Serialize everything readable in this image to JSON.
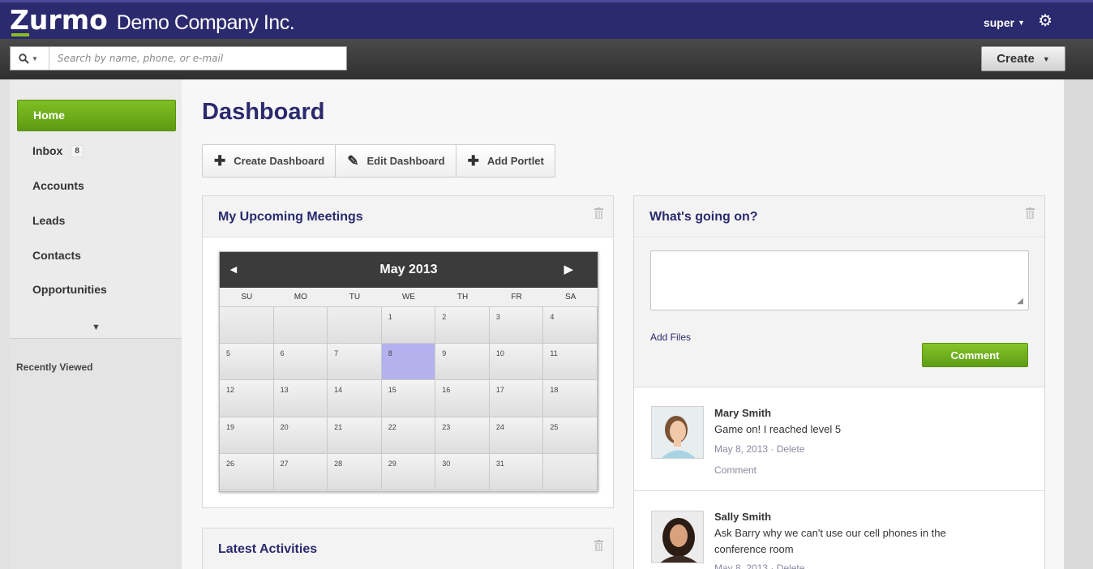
{
  "header": {
    "logo_text": "Zurmo",
    "company_name": "Demo Company Inc.",
    "user_name": "super",
    "gear_icon": "gear-icon",
    "brand_color": "#2b2a6e",
    "accent_color": "#6aaa1a"
  },
  "toolbar": {
    "search_placeholder": "Search by name, phone, or e-mail",
    "create_label": "Create"
  },
  "sidebar": {
    "items": [
      {
        "label": "Home",
        "active": true
      },
      {
        "label": "Inbox",
        "badge": "8"
      },
      {
        "label": "Accounts"
      },
      {
        "label": "Leads"
      },
      {
        "label": "Contacts"
      },
      {
        "label": "Opportunities"
      }
    ],
    "recent_label": "Recently Viewed"
  },
  "main": {
    "title": "Dashboard",
    "actions": [
      {
        "label": "Create Dashboard",
        "icon": "plus-icon"
      },
      {
        "label": "Edit Dashboard",
        "icon": "pencil-icon"
      },
      {
        "label": "Add Portlet",
        "icon": "plus-icon"
      }
    ]
  },
  "meetings": {
    "title": "My Upcoming Meetings",
    "calendar": {
      "month": "May 2013",
      "dows": [
        "SU",
        "MO",
        "TU",
        "WE",
        "TH",
        "FR",
        "SA"
      ],
      "days": [
        "",
        "",
        "",
        "1",
        "2",
        "3",
        "4",
        "5",
        "6",
        "7",
        "8",
        "9",
        "10",
        "11",
        "12",
        "13",
        "14",
        "15",
        "16",
        "17",
        "18",
        "19",
        "20",
        "21",
        "22",
        "23",
        "24",
        "25",
        "26",
        "27",
        "28",
        "29",
        "30",
        "31",
        ""
      ],
      "today": "8"
    }
  },
  "latest": {
    "title": "Latest Activities"
  },
  "social": {
    "title": "What's going on?",
    "add_files": "Add Files",
    "comment_btn": "Comment",
    "posts": [
      {
        "name": "Mary Smith",
        "text": "Game on! I reached level 5",
        "date": "May 8, 2013",
        "delete": "Delete",
        "comment": "Comment"
      },
      {
        "name": "Sally Smith",
        "text": "Ask Barry why we can't use our cell phones in the conference room",
        "date": "May 8, 2013",
        "delete": "Delete"
      }
    ]
  }
}
